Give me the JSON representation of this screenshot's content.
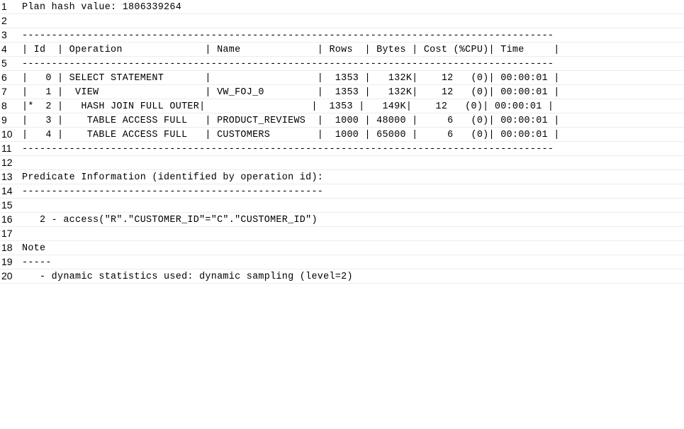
{
  "lines": [
    {
      "n": "1",
      "text": "Plan hash value: 1806339264"
    },
    {
      "n": "2",
      "text": ""
    },
    {
      "n": "3",
      "text": "------------------------------------------------------------------------------------------"
    },
    {
      "n": "4",
      "text": "| Id  | Operation              | Name             | Rows  | Bytes | Cost (%CPU)| Time     |"
    },
    {
      "n": "5",
      "text": "------------------------------------------------------------------------------------------"
    },
    {
      "n": "6",
      "text": "|   0 | SELECT STATEMENT       |                  |  1353 |   132K|    12   (0)| 00:00:01 |"
    },
    {
      "n": "7",
      "text": "|   1 |  VIEW                  | VW_FOJ_0         |  1353 |   132K|    12   (0)| 00:00:01 |"
    },
    {
      "n": "8",
      "text": "|*  2 |   HASH JOIN FULL OUTER|                  |  1353 |   149K|    12   (0)| 00:00:01 |"
    },
    {
      "n": "9",
      "text": "|   3 |    TABLE ACCESS FULL   | PRODUCT_REVIEWS  |  1000 | 48000 |     6   (0)| 00:00:01 |"
    },
    {
      "n": "10",
      "text": "|   4 |    TABLE ACCESS FULL   | CUSTOMERS        |  1000 | 65000 |     6   (0)| 00:00:01 |"
    },
    {
      "n": "11",
      "text": "------------------------------------------------------------------------------------------"
    },
    {
      "n": "12",
      "text": ""
    },
    {
      "n": "13",
      "text": "Predicate Information (identified by operation id):"
    },
    {
      "n": "14",
      "text": "---------------------------------------------------"
    },
    {
      "n": "15",
      "text": ""
    },
    {
      "n": "16",
      "text": "   2 - access(\"R\".\"CUSTOMER_ID\"=\"C\".\"CUSTOMER_ID\")"
    },
    {
      "n": "17",
      "text": ""
    },
    {
      "n": "18",
      "text": "Note"
    },
    {
      "n": "19",
      "text": "-----"
    },
    {
      "n": "20",
      "text": "   - dynamic statistics used: dynamic sampling (level=2)"
    }
  ]
}
